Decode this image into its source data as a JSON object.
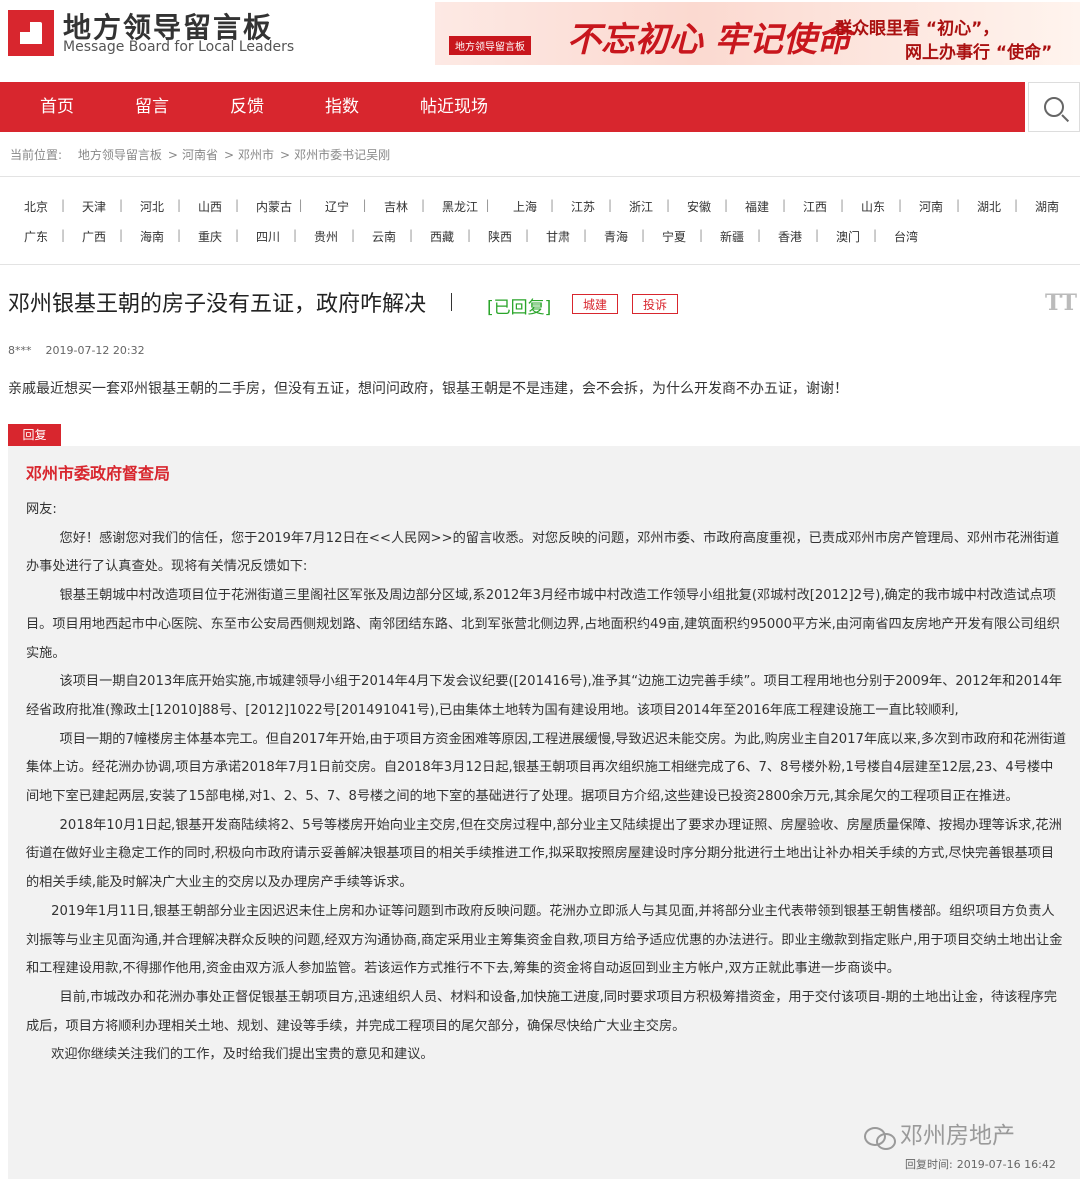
{
  "header": {
    "logo_title": "地方领导留言板",
    "logo_subtitle": "Message Board for Local Leaders",
    "banner": {
      "small_logo": "地方领导留言板",
      "big_slogan": "不忘初心 牢记使命",
      "right_line1": "群众眼里看 “初心”，",
      "right_line2": "网上办事行 “使命”"
    }
  },
  "nav": {
    "items": [
      "首页",
      "留言",
      "反馈",
      "指数",
      "帖近现场"
    ],
    "search_icon": "search-icon"
  },
  "breadcrumb": {
    "prefix": "当前位置:",
    "items": [
      "地方领导留言板",
      "河南省",
      "邓州市",
      "邓州市委书记吴刚"
    ],
    "separator": ">"
  },
  "provinces": {
    "row1": [
      "北京",
      "天津",
      "河北",
      "山西",
      "内蒙古",
      "辽宁",
      "吉林",
      "黑龙江",
      "上海",
      "江苏",
      "浙江",
      "安徽",
      "福建",
      "江西",
      "山东",
      "河南",
      "湖北",
      "湖南"
    ],
    "row2": [
      "广东",
      "广西",
      "海南",
      "重庆",
      "四川",
      "贵州",
      "云南",
      "西藏",
      "陕西",
      "甘肃",
      "青海",
      "宁夏",
      "新疆",
      "香港",
      "澳门",
      "台湾"
    ],
    "separator": "|"
  },
  "post": {
    "title": "邓州银基王朝的房子没有五证，政府咋解决",
    "status": "[已回复]",
    "tags": [
      "城建",
      "投诉"
    ],
    "font_icon": "TT",
    "author": "8***",
    "date": "2019-07-12 20:32",
    "content": "亲戚最近想买一套邓州银基王朝的二手房，但没有五证，想问问政府，银基王朝是不是违建，会不会拆，为什么开发商不办五证，谢谢！"
  },
  "reply": {
    "tag": "回复",
    "org": "邓州市委政府督查局",
    "greeting": "网友:",
    "paragraphs": [
      "        您好！感谢您对我们的信任，您于2019年7月12日在<<人民网>>的留言收悉。对您反映的问题，邓州市委、市政府高度重视，已责成邓州市房产管理局、邓州市花洲街道办事处进行了认真查处。现将有关情况反馈如下:",
      "        银基王朝城中村改造项目位于花洲街道三里阁社区军张及周边部分区域,系2012年3月经市城中村改造工作领导小组批复(邓城村改[2012]2号),确定的我市城中村改造试点项目。项目用地西起市中心医院、东至市公安局西侧规划路、南邻团结东路、北到军张营北侧边界,占地面积约49亩,建筑面积约95000平方米,由河南省四友房地产开发有限公司组织实施。",
      "        该项目一期自2013年底开始实施,市城建领导小组于2014年4月下发会议纪要([201416号),准予其“边施工边完善手续”。项目工程用地也分别于2009年、2012年和2014年经省政府批准(豫政土[12010]88号、[2012]1022号[201491041号),已由集体土地转为国有建设用地。该项目2014年至2016年底工程建设施工一直比较顺利,",
      "        项目一期的7幢楼房主体基本完工。但自2017年开始,由于项目方资金困难等原因,工程进展缓慢,导致迟迟未能交房。为此,购房业主自2017年底以来,多次到市政府和花洲街道集体上访。经花洲办协调,项目方承诺2018年7月1日前交房。自2018年3月12日起,银基王朝项目再次组织施工相继完成了6、7、8号楼外粉,1号楼自4层建至12层,23、4号楼中间地下室已建起两层,安装了15部电梯,对1、2、5、7、8号楼之间的地下室的基础进行了处理。据项目方介绍,这些建设已投资2800余万元,其余尾欠的工程项目正在推进。",
      "        2018年10月1日起,银基开发商陆续将2、5号等楼房开始向业主交房,但在交房过程中,部分业主又陆续提出了要求办理证照、房屋验收、房屋质量保障、按揭办理等诉求,花洲街道在做好业主稳定工作的同时,积极向市政府请示妥善解决银基项目的相关手续推进工作,拟采取按照房屋建设时序分期分批进行土地出让补办相关手续的方式,尽快完善银基项目的相关手续,能及时解决广大业主的交房以及办理房产手续等诉求。",
      "      2019年1月11日,银基王朝部分业主因迟迟未住上房和办证等问题到市政府反映问题。花洲办立即派人与其见面,并将部分业主代表带领到银基王朝售楼部。组织项目方负责人刘振等与业主见面沟通,并合理解决群众反映的问题,经双方沟通协商,商定采用业主筹集资金自救,项目方给予适应优惠的办法进行。即业主缴款到指定账户,用于项目交纳土地出让金和工程建设用款,不得挪作他用,资金由双方派人参加监管。若该运作方式推行不下去,筹集的资金将自动返回到业主方帐户,双方正就此事进一步商谈中。",
      "        目前,市城改办和花洲办事处正督促银基王朝项目方,迅速组织人员、材料和设备,加快施工进度,同时要求项目方积极筹措资金，用于交付该项目-期的土地出让金，待该程序完成后，项目方将顺利办理相关土地、规划、建设等手续，并完成工程项目的尾欠部分，确保尽快给广大业主交房。",
      "      欢迎你继续关注我们的工作，及时给我们提出宝贵的意见和建议。"
    ],
    "watermark": "邓州房地产",
    "reply_time_label": "回复时间:",
    "reply_time": "2019-07-16 16:42"
  },
  "colors": {
    "brand_red": "#d8262e",
    "replied_green": "#2aa52a",
    "reply_bg": "#f2f2f2"
  }
}
